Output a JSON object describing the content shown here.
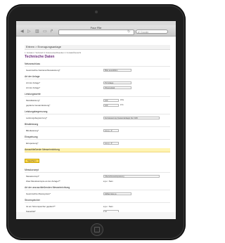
{
  "browser": {
    "title": "Four File",
    "search_placeholder": "Google",
    "back_icon": "◀",
    "forward_icon": "▷",
    "bookmarks_icon": "▥",
    "tabs_icon": "▭",
    "share_icon": "↱",
    "reload_icon": "↻"
  },
  "page": {
    "band": "Ertrem > Erzeugungsanlage",
    "breadcrumb": "1. Kontakt  2. Technisch  3. Dokumente/Absenden  4. Kontakt/Übersicht",
    "title": "Technische Daten"
  },
  "sections": [
    {
      "heading": "Netzanschluss",
      "rows": [
        {
          "label": "Gewünschte Netzanschlussleistung*",
          "value": "Bitte auswählen",
          "type": "select"
        }
      ]
    },
    {
      "heading": "Art der Anlage",
      "rows": [
        {
          "label": "Art der Anlage*",
          "value": "PV-Anlage",
          "type": "select"
        },
        {
          "label": "Art der Anlage*",
          "value": "Photovoltaik",
          "type": "select"
        }
      ]
    },
    {
      "heading": "Leistungswerte",
      "rows": [
        {
          "label": "Modulleistung*",
          "value": "100",
          "unit": "kWp",
          "type": "input"
        },
        {
          "label": "geplante Gesamtleistung*",
          "value": "100",
          "unit": "kVA",
          "type": "input"
        }
      ]
    },
    {
      "heading": "Leistungsbegrenzung",
      "rows": [
        {
          "label": "Leistungsbegrenzung*",
          "value": "Fernsteuerung (Gesamtanlage) bis 0 kW",
          "type": "select-wide"
        }
      ]
    },
    {
      "heading": "Blindleistung",
      "rows": [
        {
          "label": "Blindleistung*",
          "value": "cos φ - P",
          "type": "select-short"
        }
      ]
    },
    {
      "heading": "Einspeisung",
      "rows": [
        {
          "label": "Einspeisung*",
          "value": "cos φ - P",
          "type": "select-short"
        }
      ]
    }
  ],
  "highlight_section": {
    "heading": "Ausschließende Messeinrichtung",
    "button": "Speichern"
  },
  "messkonzept": {
    "heading": "Messkonzept",
    "rows": [
      {
        "label": "Messkonzept*",
        "value": "Überschusseinspeisung"
      },
      {
        "label": "Zwei Messkonzepte an der Anlage?*",
        "yes": "ja",
        "no": "Nein"
      }
    ]
  },
  "additional": {
    "heading": "Art der anzuschließenden Messeinrichtung",
    "row": {
      "label": "Gewünschte Messsystem*",
      "value": "Zählermiete ja"
    }
  },
  "storage": {
    "heading": "Stromspeicher",
    "rows": [
      {
        "label": "Ist ein Stromspeicher geplant?*",
        "yes": "ja",
        "no": "Nein"
      },
      {
        "label": "Kapazität*",
        "value": "10"
      },
      {
        "label": "Leistung*",
        "value": "10"
      }
    ]
  }
}
